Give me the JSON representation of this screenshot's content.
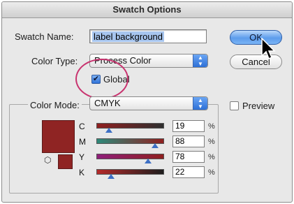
{
  "dialog": {
    "title": "Swatch Options"
  },
  "swatch_name": {
    "label": "Swatch Name:",
    "value": "label background"
  },
  "color_type": {
    "label": "Color Type:",
    "selected": "Process Color"
  },
  "global": {
    "label": "Global",
    "checked": true
  },
  "color_mode": {
    "label": "Color Mode:",
    "selected": "CMYK"
  },
  "buttons": {
    "ok": "OK",
    "cancel": "Cancel"
  },
  "preview": {
    "label": "Preview",
    "checked": false
  },
  "channels": [
    {
      "name": "C",
      "value": "19",
      "unit": "%",
      "level": 0.19,
      "gradient": "linear-gradient(90deg, #8f1f1f, #2e2f2f)"
    },
    {
      "name": "M",
      "value": "88",
      "unit": "%",
      "level": 0.88,
      "gradient": "linear-gradient(90deg, #2d8a7a, #8f1f1f)"
    },
    {
      "name": "Y",
      "value": "78",
      "unit": "%",
      "level": 0.78,
      "gradient": "linear-gradient(90deg, #8f1f7a, #8f1f1f)"
    },
    {
      "name": "K",
      "value": "22",
      "unit": "%",
      "level": 0.22,
      "gradient": "linear-gradient(90deg, #b42a2a, #1d1d1d)"
    }
  ],
  "colors": {
    "swatch": "#8f2423",
    "accent": "#2d6fd6",
    "highlight": "#c8326e"
  },
  "icons": {
    "gamut": "cube-icon",
    "pointer": "arrow-cursor-icon"
  }
}
